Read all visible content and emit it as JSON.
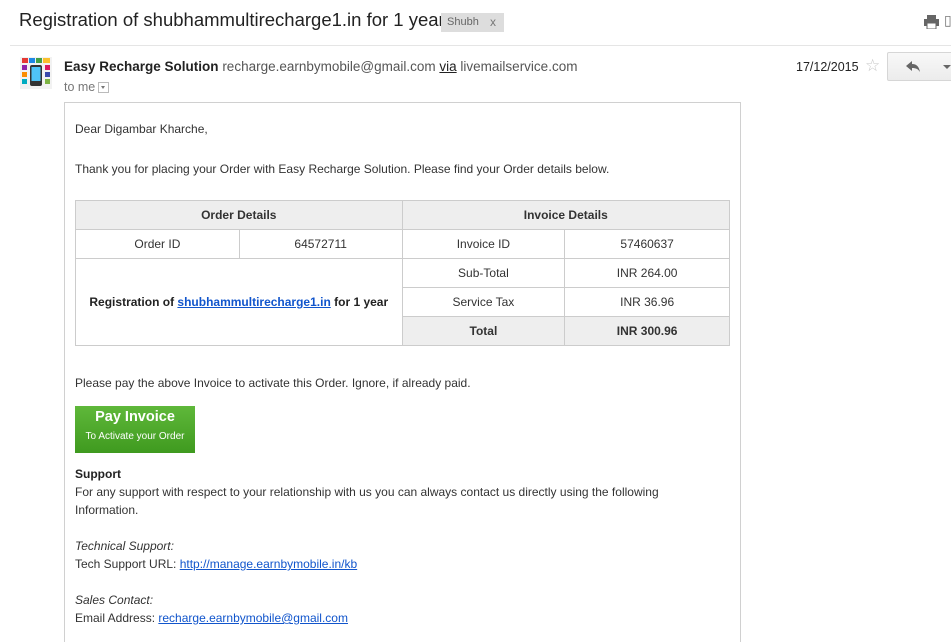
{
  "thread": {
    "subject": "Registration of shubhammultirecharge1.in for 1 year",
    "label": "Shubh",
    "label_remove": "x"
  },
  "message": {
    "sender_name": "Easy Recharge Solution",
    "sender_email": "recharge.earnbymobile@gmail.com",
    "via_label": "via",
    "via_domain": "livemailservice.com",
    "recipient": "to me",
    "date": "17/12/2015",
    "star_glyph": "☆"
  },
  "body": {
    "greeting": "Dear Digambar Kharche,",
    "intro": "Thank you for placing your Order with Easy Recharge Solution. Please find your Order details below.",
    "table": {
      "order_header": "Order Details",
      "invoice_header": "Invoice Details",
      "order_id_label": "Order ID",
      "order_id_value": "64572711",
      "invoice_id_label": "Invoice ID",
      "invoice_id_value": "57460637",
      "desc_prefix": "Registration of ",
      "desc_domain": "shubhammultirecharge1.in",
      "desc_suffix": " for 1 year",
      "subtotal_label": "Sub-Total",
      "subtotal_value": "INR 264.00",
      "tax_label": "Service Tax",
      "tax_value": "INR 36.96",
      "total_label": "Total",
      "total_value": "INR 300.96"
    },
    "pay_note": "Please pay the above Invoice to activate this Order. Ignore, if already paid.",
    "pay_button_title": "Pay Invoice",
    "pay_button_sub": "To Activate your Order",
    "support_heading": "Support",
    "support_text": "For any support with respect to your relationship with us you can always contact us directly using the following Information.",
    "tech_heading": "Technical Support:",
    "tech_label": "Tech Support URL: ",
    "tech_url": "http://manage.earnbymobile.in/kb",
    "sales_heading": "Sales Contact:",
    "sales_label": "Email Address: ",
    "sales_email": "recharge.earnbymobile@gmail.com"
  },
  "colors": {
    "link": "#1155cc",
    "pay_button": "#4aa52a",
    "table_header_bg": "#eeeeee"
  }
}
